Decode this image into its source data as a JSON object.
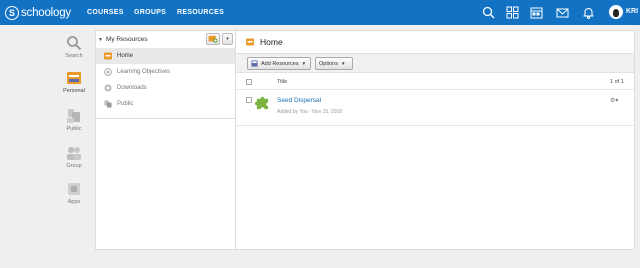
{
  "brand": {
    "logo_mark": "S",
    "name": "schoology"
  },
  "nav": {
    "courses": "COURSES",
    "groups": "GROUPS",
    "resources": "RESOURCES"
  },
  "topbar_icons": [
    "search-icon",
    "apps-grid-icon",
    "calendar-icon",
    "mail-icon",
    "notifications-icon"
  ],
  "user": {
    "name": "KRI"
  },
  "rail": {
    "search": "Search",
    "personal": "Personal",
    "public": "Public",
    "group": "Group",
    "apps": "Apps"
  },
  "left_panel": {
    "header": "My Resources",
    "items": [
      {
        "label": "Home",
        "selected": true
      },
      {
        "label": "Learning Objectives"
      },
      {
        "label": "Downloads"
      },
      {
        "label": "Public"
      }
    ]
  },
  "main": {
    "title": "Home",
    "toolbar": {
      "add_resources": "Add Resources",
      "options": "Options"
    },
    "table": {
      "col_title": "Title",
      "pagination": "1 of 1",
      "rows": [
        {
          "title": "Seed Dispersal",
          "meta": "Added by You · Nov 15, 2018"
        }
      ]
    }
  },
  "colors": {
    "nav_blue": "#1273c4",
    "link_blue": "#1a6fb5",
    "folder_orange": "#e89b2b",
    "puzzle_green": "#7cb342"
  }
}
